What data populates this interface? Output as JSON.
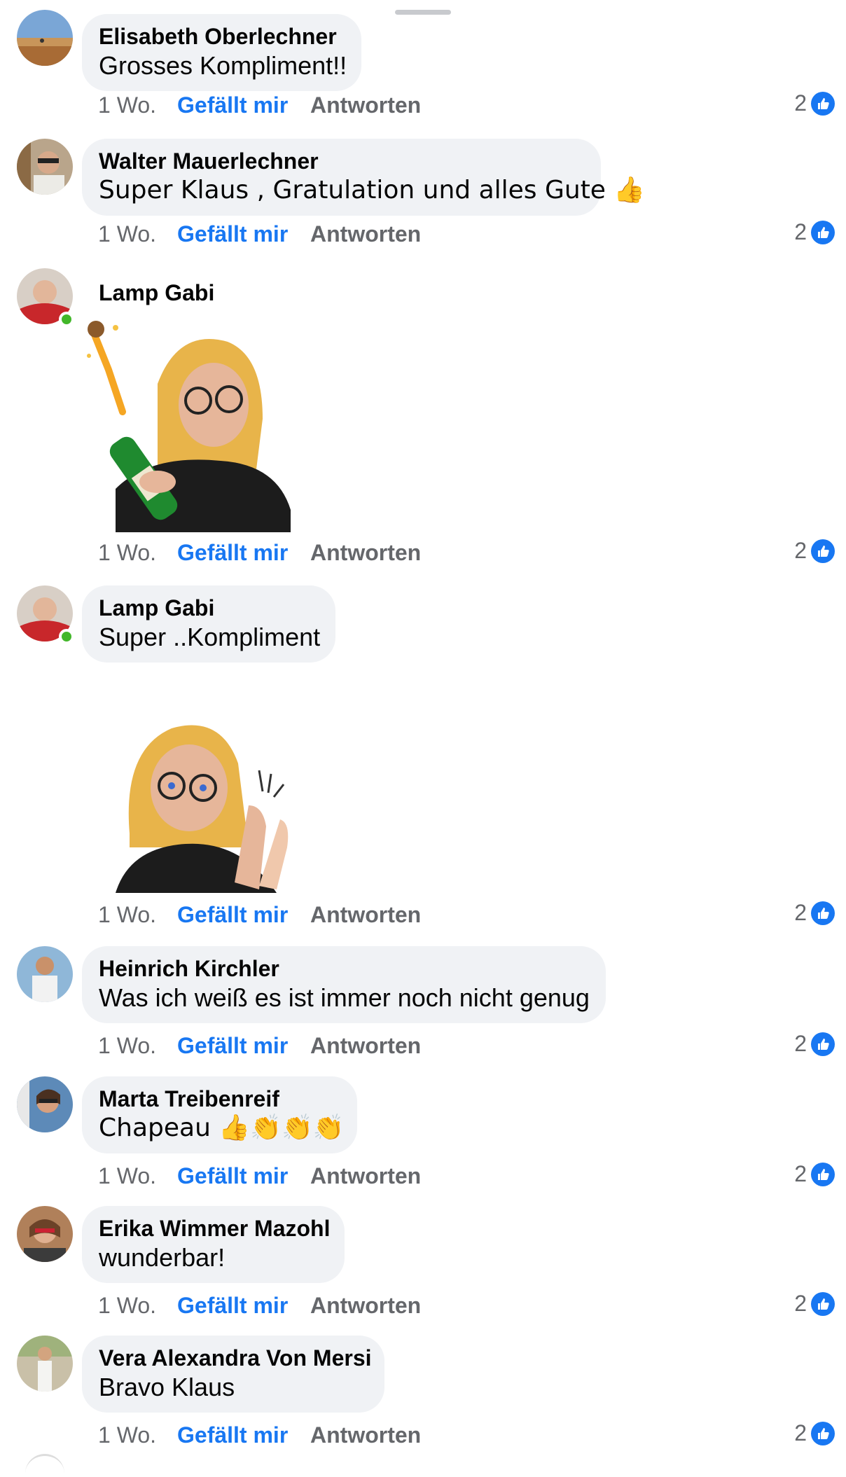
{
  "comments": [
    {
      "name": "Elisabeth Oberlechner",
      "text": "Grosses Kompliment!!",
      "time": "1 Wo.",
      "like": "Gefällt mir",
      "reply": "Antworten",
      "reactions": "2"
    },
    {
      "name": "Walter Mauerlechner",
      "text": "Super Klaus , Gratulation und alles Gute 👍",
      "time": "1 Wo.",
      "like": "Gefällt mir",
      "reply": "Antworten",
      "reactions": "2"
    },
    {
      "name": "Lamp Gabi",
      "text": "",
      "time": "1 Wo.",
      "like": "Gefällt mir",
      "reply": "Antworten",
      "reactions": "2"
    },
    {
      "name": "Lamp Gabi",
      "text": "Super ..Kompliment",
      "time": "1 Wo.",
      "like": "Gefällt mir",
      "reply": "Antworten",
      "reactions": "2"
    },
    {
      "name": "Heinrich Kirchler",
      "text": "Was ich weiß es ist immer noch nicht genug",
      "time": "1 Wo.",
      "like": "Gefällt mir",
      "reply": "Antworten",
      "reactions": "2"
    },
    {
      "name": "Marta Treibenreif",
      "text": "Chapeau 👍👏👏👏",
      "time": "1 Wo.",
      "like": "Gefällt mir",
      "reply": "Antworten",
      "reactions": "2"
    },
    {
      "name": "Erika Wimmer Mazohl",
      "text": "wunderbar!",
      "time": "1 Wo.",
      "like": "Gefällt mir",
      "reply": "Antworten",
      "reactions": "2"
    },
    {
      "name": "Vera Alexandra Von Mersi",
      "text": "Bravo Klaus",
      "time": "1 Wo.",
      "like": "Gefällt mir",
      "reply": "Antworten",
      "reactions": "2"
    }
  ],
  "colors": {
    "accent": "#1877f2",
    "bubble": "#f0f2f5",
    "online": "#42b72a",
    "meta": "#65676b"
  },
  "icons": {
    "reaction": "thumbs-up-icon"
  }
}
